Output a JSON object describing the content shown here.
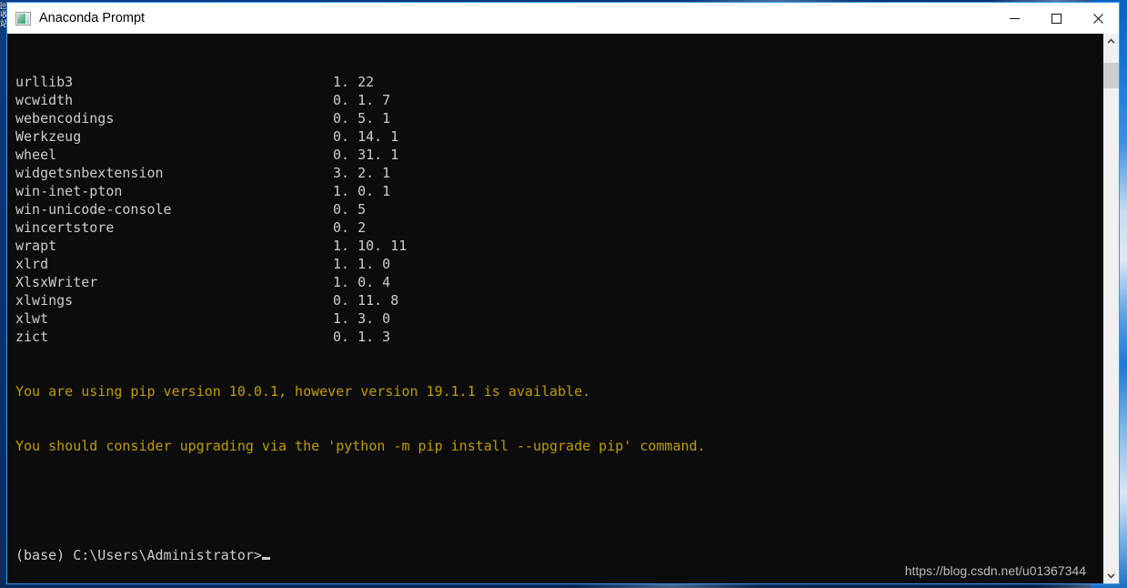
{
  "desktop": {
    "icon_fragment_text": "回收站"
  },
  "window": {
    "title": "Anaconda Prompt",
    "app_icon": "console-window-icon",
    "controls": {
      "minimize": "minimize-icon",
      "maximize": "maximize-icon",
      "close": "close-icon"
    }
  },
  "console": {
    "packages": [
      {
        "name": "urllib3",
        "version": "1. 22"
      },
      {
        "name": "wcwidth",
        "version": "0. 1. 7"
      },
      {
        "name": "webencodings",
        "version": "0. 5. 1"
      },
      {
        "name": "Werkzeug",
        "version": "0. 14. 1"
      },
      {
        "name": "wheel",
        "version": "0. 31. 1"
      },
      {
        "name": "widgetsnbextension",
        "version": "3. 2. 1"
      },
      {
        "name": "win-inet-pton",
        "version": "1. 0. 1"
      },
      {
        "name": "win-unicode-console",
        "version": "0. 5"
      },
      {
        "name": "wincertstore",
        "version": "0. 2"
      },
      {
        "name": "wrapt",
        "version": "1. 10. 11"
      },
      {
        "name": "xlrd",
        "version": "1. 1. 0"
      },
      {
        "name": "XlsxWriter",
        "version": "1. 0. 4"
      },
      {
        "name": "xlwings",
        "version": "0. 11. 8"
      },
      {
        "name": "xlwt",
        "version": "1. 3. 0"
      },
      {
        "name": "zict",
        "version": "0. 1. 3"
      }
    ],
    "warning_line_1": "You are using pip version 10.0.1, however version 19.1.1 is available.",
    "warning_line_2": "You should consider upgrading via the 'python -m pip install --upgrade pip' command.",
    "prompt": "(base) C:\\Users\\Administrator>",
    "colors": {
      "background": "#0c0c0c",
      "text": "#cccccc",
      "warning": "#c19c00"
    }
  },
  "watermark": {
    "text": "https://blog.csdn.net/u01367344"
  },
  "scrollbar": {
    "up_arrow": "chevron-up-icon",
    "down_arrow": "chevron-down-icon"
  }
}
